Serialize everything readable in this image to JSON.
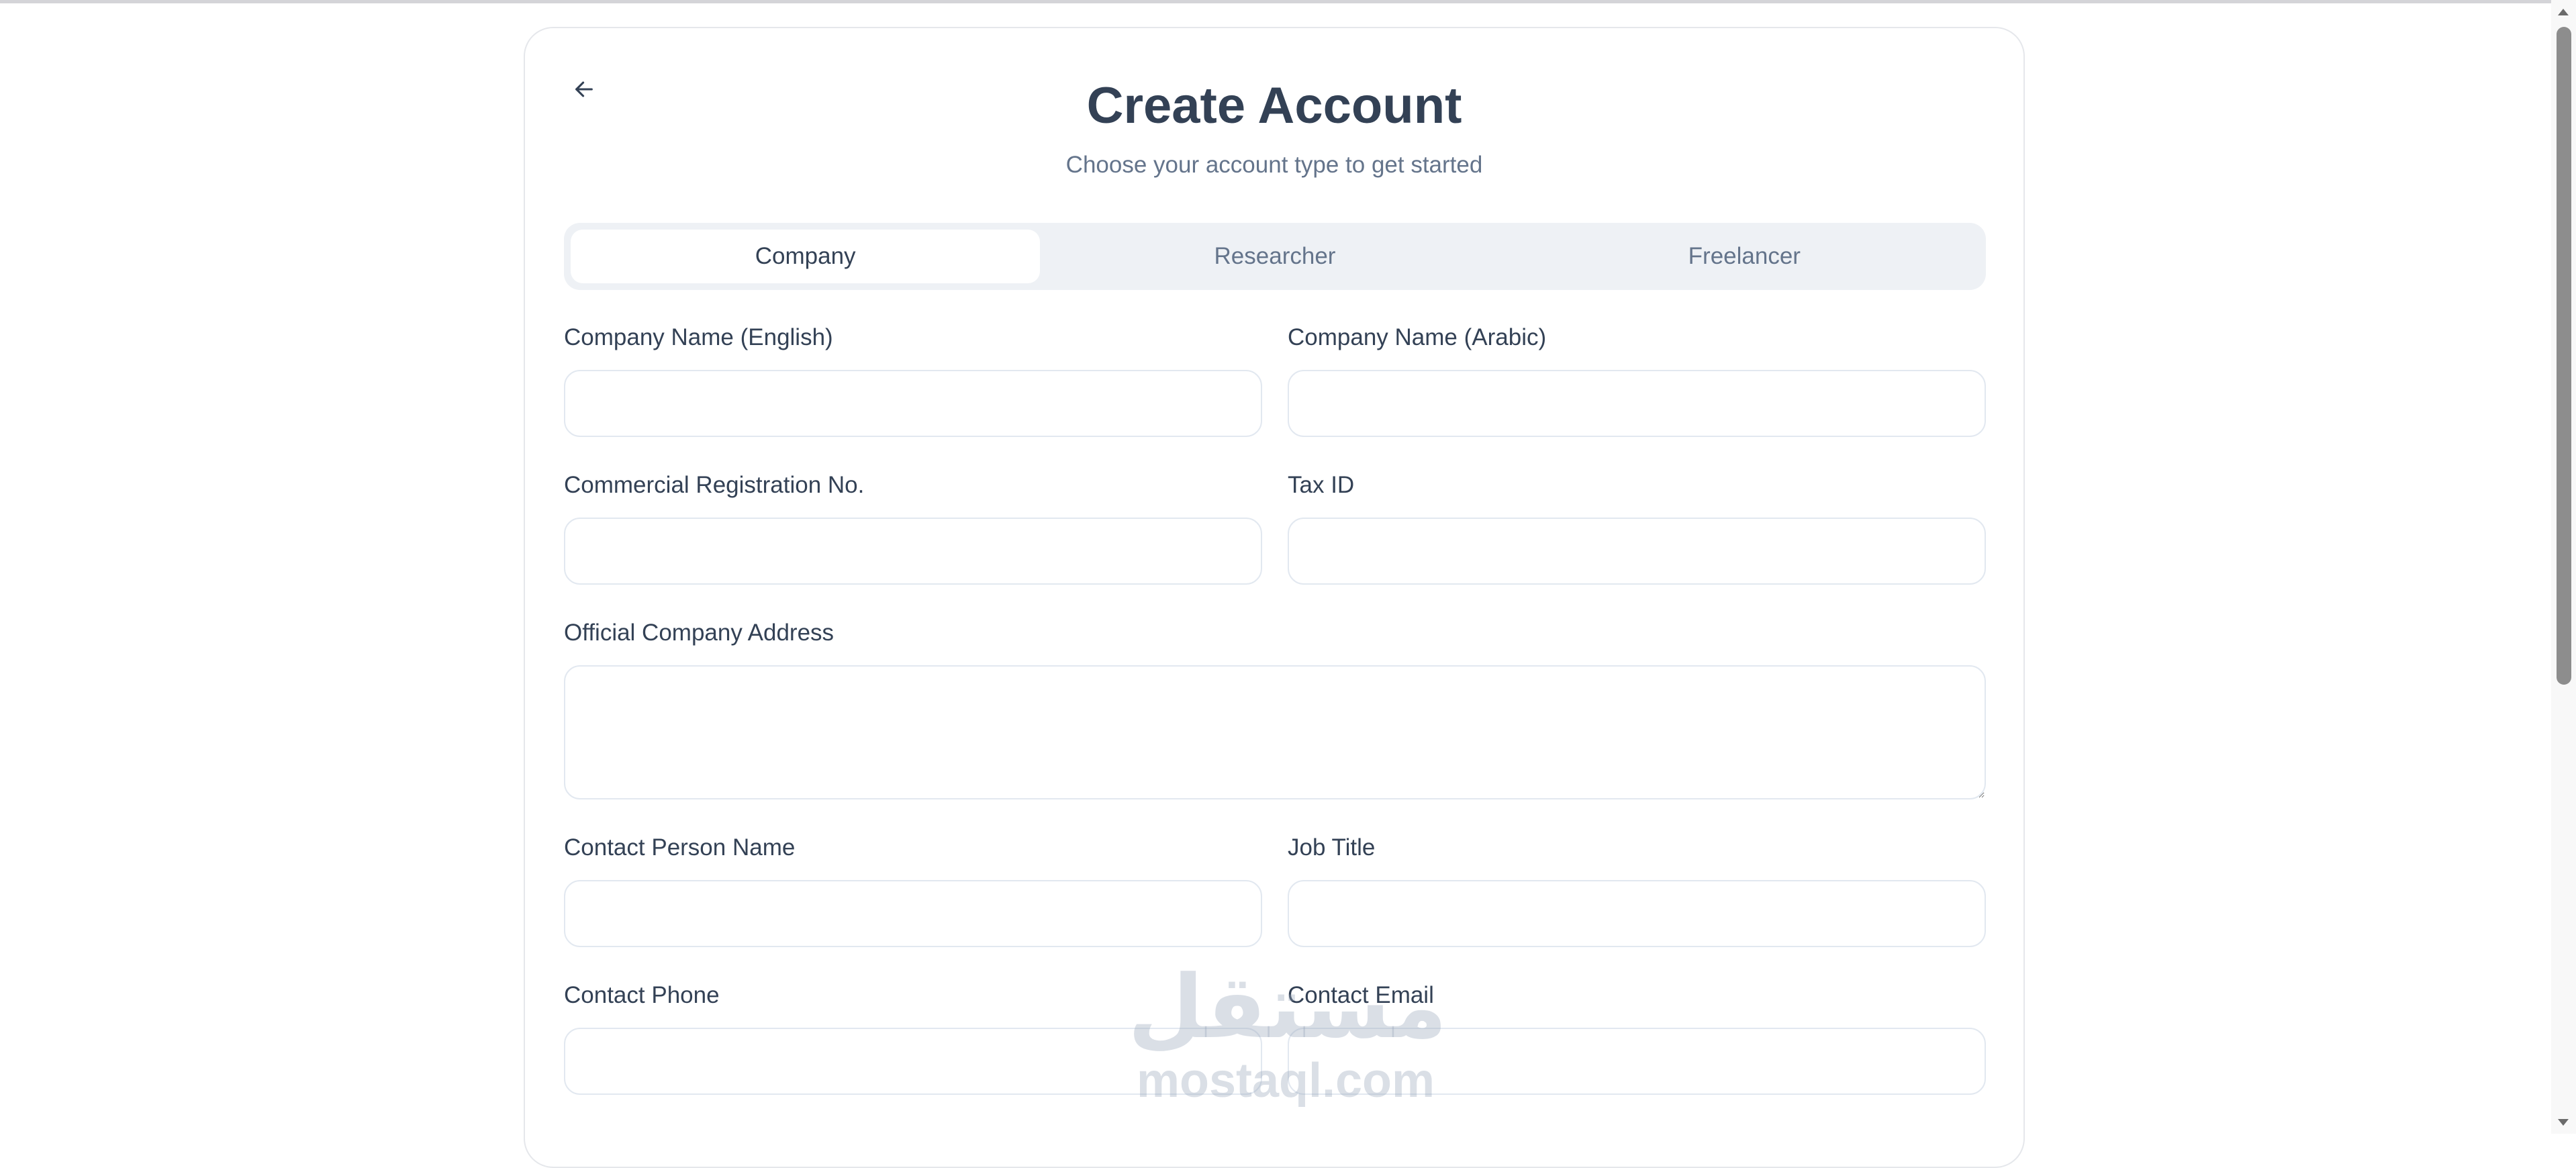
{
  "header": {
    "title": "Create Account",
    "subtitle": "Choose your account type to get started"
  },
  "tabs": [
    {
      "label": "Company",
      "active": true
    },
    {
      "label": "Researcher",
      "active": false
    },
    {
      "label": "Freelancer",
      "active": false
    }
  ],
  "form": {
    "company_name_en": {
      "label": "Company Name (English)",
      "value": ""
    },
    "company_name_ar": {
      "label": "Company Name (Arabic)",
      "value": ""
    },
    "commercial_reg_no": {
      "label": "Commercial Registration No.",
      "value": ""
    },
    "tax_id": {
      "label": "Tax ID",
      "value": ""
    },
    "official_address": {
      "label": "Official Company Address",
      "value": ""
    },
    "contact_person_name": {
      "label": "Contact Person Name",
      "value": ""
    },
    "job_title": {
      "label": "Job Title",
      "value": ""
    },
    "contact_phone": {
      "label": "Contact Phone",
      "value": ""
    },
    "contact_email": {
      "label": "Contact Email",
      "value": ""
    }
  },
  "watermark": {
    "arabic": "مستقل",
    "latin": "mostaql.com"
  },
  "colors": {
    "text": "#334155",
    "muted": "#64748b",
    "border": "#e2e8f0",
    "tabs_bg": "#eef1f5"
  },
  "icons": {
    "back": "arrow-left-icon"
  }
}
